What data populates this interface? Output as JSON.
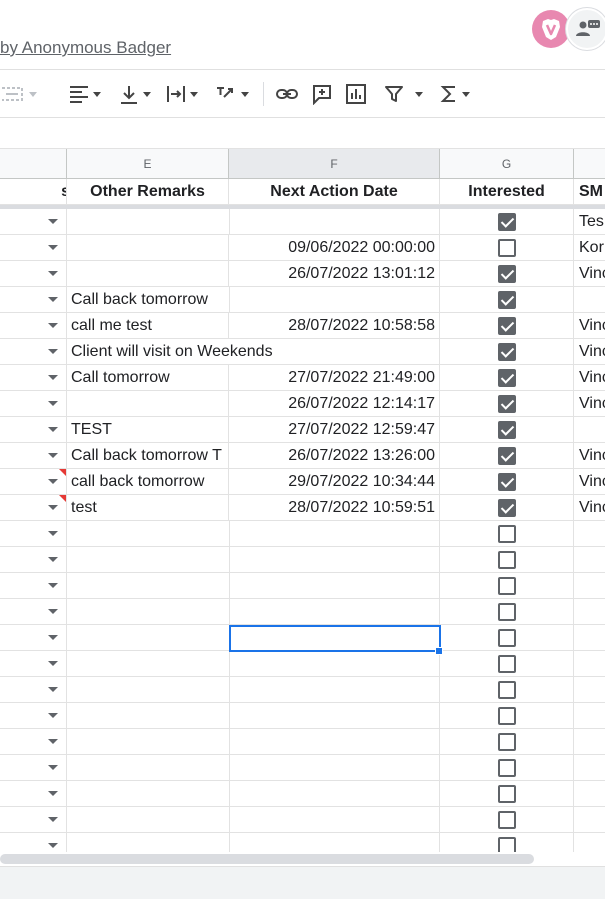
{
  "header": {
    "last_edit_text": "by Anonymous Badger",
    "avatar_icon": "brave-lion-icon",
    "share_icon": "account-chat-icon"
  },
  "toolbar": {
    "icons": [
      "merge-cells-icon",
      "horizontal-align-icon",
      "vertical-align-icon",
      "text-wrap-icon",
      "text-rotate-icon",
      "insert-link-icon",
      "insert-comment-icon",
      "insert-chart-icon",
      "filter-icon",
      "functions-icon"
    ]
  },
  "columns": {
    "letters": [
      "E",
      "F",
      "G"
    ],
    "selected": "F"
  },
  "headers": {
    "d": "s",
    "e": "Other Remarks",
    "f": "Next Action Date",
    "g": "Interested",
    "h": "SM"
  },
  "rows": [
    {
      "e": "",
      "f": "",
      "g": true,
      "h": "Tes",
      "note": false
    },
    {
      "e": "",
      "f": "09/06/2022 00:00:00",
      "g": false,
      "h": "Kor",
      "note": false
    },
    {
      "e": "",
      "f": "26/07/2022 13:01:12",
      "g": true,
      "h": "Vinc",
      "note": false
    },
    {
      "e": "Call back tomorrow",
      "f": "",
      "g": true,
      "h": "",
      "note": false
    },
    {
      "e": "call me test",
      "f": "28/07/2022 10:58:58",
      "g": true,
      "h": "Vinc",
      "note": false
    },
    {
      "e": "Client will visit on Weekends",
      "f": "",
      "g": true,
      "h": "Vinc",
      "note": false
    },
    {
      "e": "Call tomorrow",
      "f": "27/07/2022 21:49:00",
      "g": true,
      "h": "Vinc",
      "note": false
    },
    {
      "e": "",
      "f": "26/07/2022 12:14:17",
      "g": true,
      "h": "Vinc",
      "note": false
    },
    {
      "e": "TEST",
      "f": "27/07/2022 12:59:47",
      "g": true,
      "h": "",
      "note": false
    },
    {
      "e": "Call back tomorrow T",
      "f": "26/07/2022 13:26:00",
      "g": true,
      "h": "Vinc",
      "note": false
    },
    {
      "e": "call back tomorrow",
      "f": "29/07/2022 10:34:44",
      "g": true,
      "h": "Vinc",
      "note": true
    },
    {
      "e": "test",
      "f": "28/07/2022 10:59:51",
      "g": true,
      "h": "Vinc",
      "note": true
    },
    {
      "e": "",
      "f": "",
      "g": false,
      "h": "",
      "note": false
    },
    {
      "e": "",
      "f": "",
      "g": false,
      "h": "",
      "note": false
    },
    {
      "e": "",
      "f": "",
      "g": false,
      "h": "",
      "note": false
    },
    {
      "e": "",
      "f": "",
      "g": false,
      "h": "",
      "note": false
    },
    {
      "e": "",
      "f": "",
      "g": false,
      "h": "",
      "note": false
    },
    {
      "e": "",
      "f": "",
      "g": false,
      "h": "",
      "note": false
    },
    {
      "e": "",
      "f": "",
      "g": false,
      "h": "",
      "note": false
    },
    {
      "e": "",
      "f": "",
      "g": false,
      "h": "",
      "note": false
    },
    {
      "e": "",
      "f": "",
      "g": false,
      "h": "",
      "note": false
    },
    {
      "e": "",
      "f": "",
      "g": false,
      "h": "",
      "note": false
    },
    {
      "e": "",
      "f": "",
      "g": false,
      "h": "",
      "note": false
    },
    {
      "e": "",
      "f": "",
      "g": false,
      "h": "",
      "note": false
    },
    {
      "e": "",
      "f": "",
      "g": false,
      "h": "",
      "note": false
    },
    {
      "e": "",
      "f": "",
      "g": false,
      "h": "",
      "note": false
    }
  ],
  "colors": {
    "accent": "#1a73e8",
    "note_marker": "#e53935",
    "avatar_bg": "#e888b0"
  }
}
